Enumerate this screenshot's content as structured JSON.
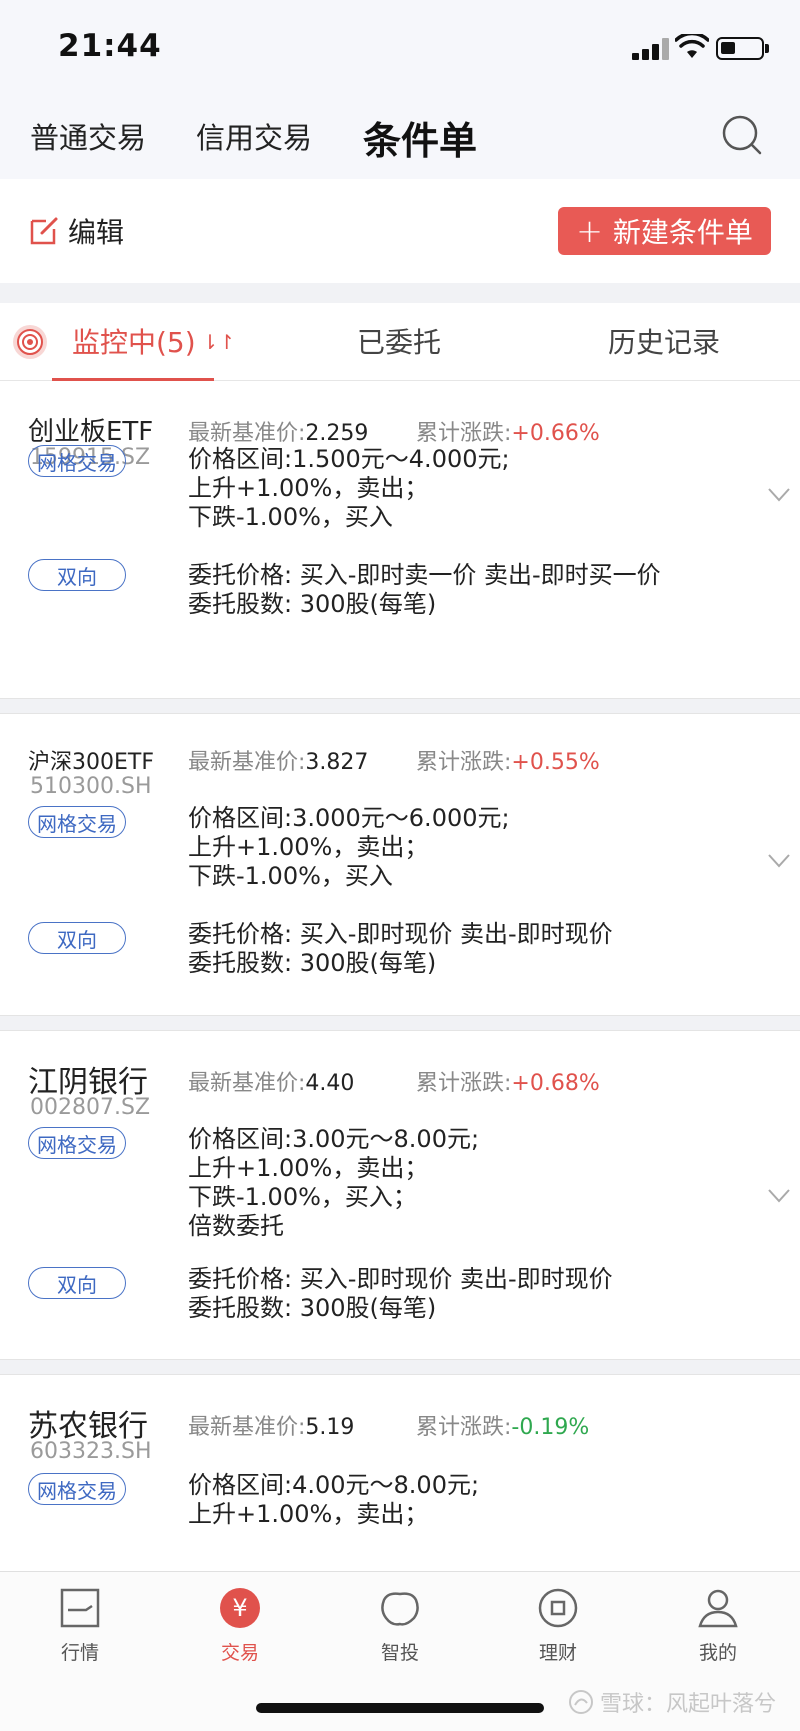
{
  "status_bar": {
    "time": "21:44"
  },
  "top_nav": {
    "tabs": [
      "普通交易",
      "信用交易",
      "条件单"
    ],
    "active_index": 2
  },
  "action_bar": {
    "edit_label": "编辑",
    "new_label": "新建条件单",
    "new_plus": "+"
  },
  "sub_tabs": {
    "items": [
      "监控中(5)",
      "已委托",
      "历史记录"
    ],
    "active_index": 0,
    "sort_glyph": "⇂↾"
  },
  "labels": {
    "base_price": "最新基准价:",
    "change": "累计涨跌:"
  },
  "orders": [
    {
      "name": "创业板ETF",
      "code": "159915.SZ",
      "base_price": "2.259",
      "change": "+0.66%",
      "change_dir": "up",
      "type_tag": "网格交易",
      "rules": [
        "价格区间:1.500元～4.000元;",
        "上升+1.00%，卖出；",
        "下跌-1.00%，买入"
      ],
      "direction_tag": "双向",
      "entrust": [
        "委托价格: 买入-即时卖一价 卖出-即时买一价",
        "委托股数: 300股(每笔)"
      ]
    },
    {
      "name": "沪深300ETF",
      "code": "510300.SH",
      "base_price": "3.827",
      "change": "+0.55%",
      "change_dir": "up",
      "type_tag": "网格交易",
      "rules": [
        "价格区间:3.000元～6.000元;",
        "上升+1.00%，卖出；",
        "下跌-1.00%，买入"
      ],
      "direction_tag": "双向",
      "entrust": [
        "委托价格: 买入-即时现价 卖出-即时现价",
        "委托股数: 300股(每笔)"
      ]
    },
    {
      "name": "江阴银行",
      "code": "002807.SZ",
      "base_price": "4.40",
      "change": "+0.68%",
      "change_dir": "up",
      "type_tag": "网格交易",
      "rules": [
        "价格区间:3.00元～8.00元;",
        "上升+1.00%，卖出；",
        "下跌-1.00%，买入；",
        "倍数委托"
      ],
      "direction_tag": "双向",
      "entrust": [
        "委托价格: 买入-即时现价 卖出-即时现价",
        "委托股数: 300股(每笔)"
      ]
    },
    {
      "name": "苏农银行",
      "code": "603323.SH",
      "base_price": "5.19",
      "change": "-0.19%",
      "change_dir": "down",
      "type_tag": "网格交易",
      "rules": [
        "价格区间:4.00元～8.00元;",
        "上升+1.00%，卖出；"
      ]
    }
  ],
  "tab_bar": {
    "items": [
      "行情",
      "交易",
      "智投",
      "理财",
      "我的"
    ],
    "active_index": 1,
    "trade_glyph": "¥"
  },
  "watermark": "雪球：风起叶落兮",
  "colors": {
    "accent_red": "#e85a55",
    "up_red": "#e0524c",
    "down_green": "#2fa84f",
    "tag_blue": "#4a73c6"
  }
}
